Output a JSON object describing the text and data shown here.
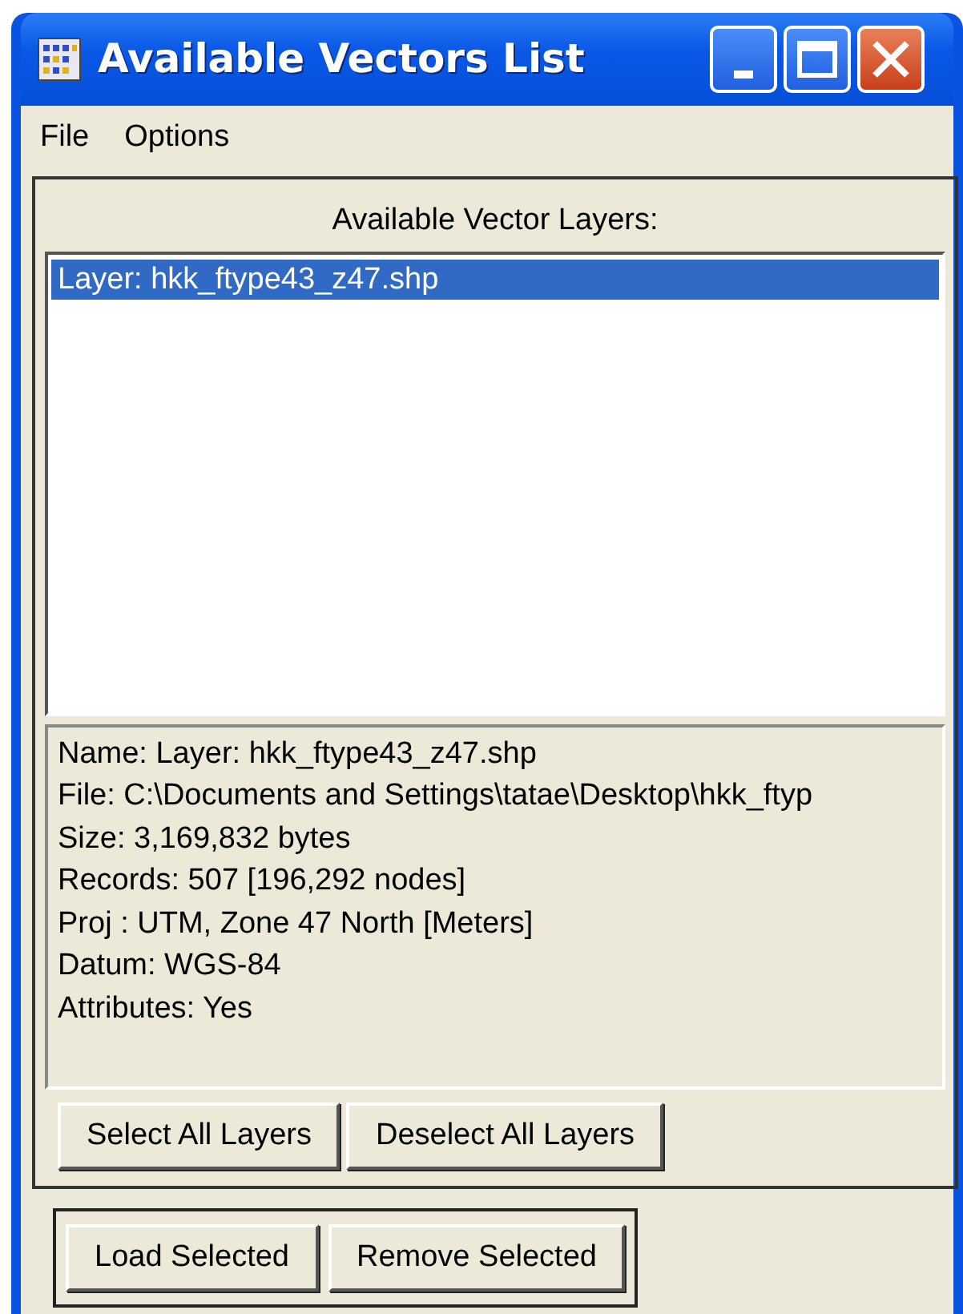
{
  "window": {
    "title": "Available Vectors List"
  },
  "menu": [
    "File",
    "Options"
  ],
  "layers_label": "Available Vector Layers:",
  "layers": [
    {
      "label": "Layer: hkk_ftype43_z47.shp",
      "selected": true
    }
  ],
  "info": [
    "Name: Layer: hkk_ftype43_z47.shp",
    "File: C:\\Documents and Settings\\tatae\\Desktop\\hkk_ftyp",
    "Size: 3,169,832 bytes",
    "Records: 507 [196,292 nodes]",
    "Proj : UTM, Zone 47 North [Meters]",
    "Datum: WGS-84",
    "Attributes: Yes"
  ],
  "layer_buttons": [
    "Select All Layers",
    "Deselect All Layers"
  ],
  "action_buttons": [
    "Load Selected",
    "Remove Selected"
  ]
}
